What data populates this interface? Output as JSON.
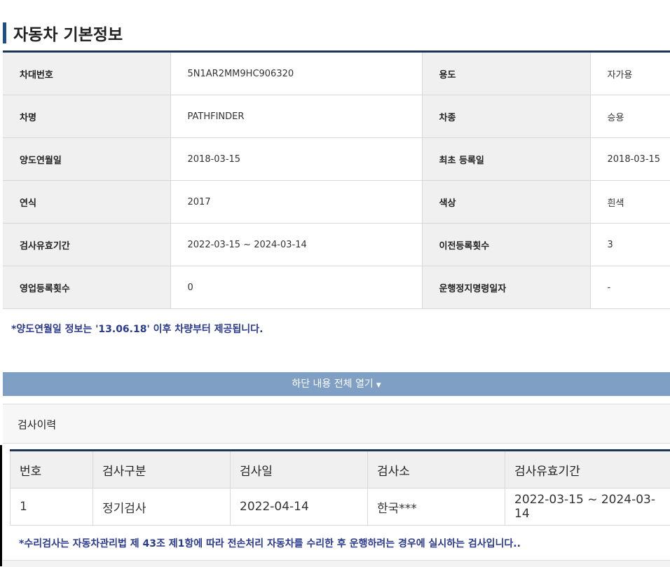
{
  "section_title": "자동차 기본정보",
  "info_rows": [
    {
      "label1": "차대번호",
      "value1": "5N1AR2MM9HC906320",
      "label2": "용도",
      "value2": "자가용"
    },
    {
      "label1": "차명",
      "value1": "PATHFINDER",
      "label2": "차종",
      "value2": "승용"
    },
    {
      "label1": "양도연월일",
      "value1": "2018-03-15",
      "label2": "최초 등록일",
      "value2": "2018-03-15"
    },
    {
      "label1": "연식",
      "value1": "2017",
      "label2": "색상",
      "value2": "흰색"
    },
    {
      "label1": "검사유효기간",
      "value1": "2022-03-15 ~ 2024-03-14",
      "label2": "이전등록횟수",
      "value2": "3"
    },
    {
      "label1": "영업등록횟수",
      "value1": "0",
      "label2": "운행정지명령일자",
      "value2": "-"
    }
  ],
  "notice_transfer": "*양도연월일 정보는 '13.06.18' 이후 차량부터 제공됩니다.",
  "expand_button": {
    "label": "하단 내용 전체 열기",
    "icon": "▼"
  },
  "history_title": "검사이력",
  "history_table": {
    "headers": [
      "번호",
      "검사구분",
      "검사일",
      "검사소",
      "검사유효기간"
    ],
    "rows": [
      [
        "1",
        "정기검사",
        "2022-04-14",
        "한국***",
        "2022-03-15 ~ 2024-03-14"
      ]
    ]
  },
  "notice_repair": "*수리검사는 자동차관리법 제 43조 제1항에 따라 전손처리 자동차를 수리한 후 운행하려는 경우에 실시하는 검사입니다..",
  "colors": {
    "accent": "#1e4f8a",
    "notice": "#2a3a8c",
    "expand_bar": "#7f9fc4"
  }
}
